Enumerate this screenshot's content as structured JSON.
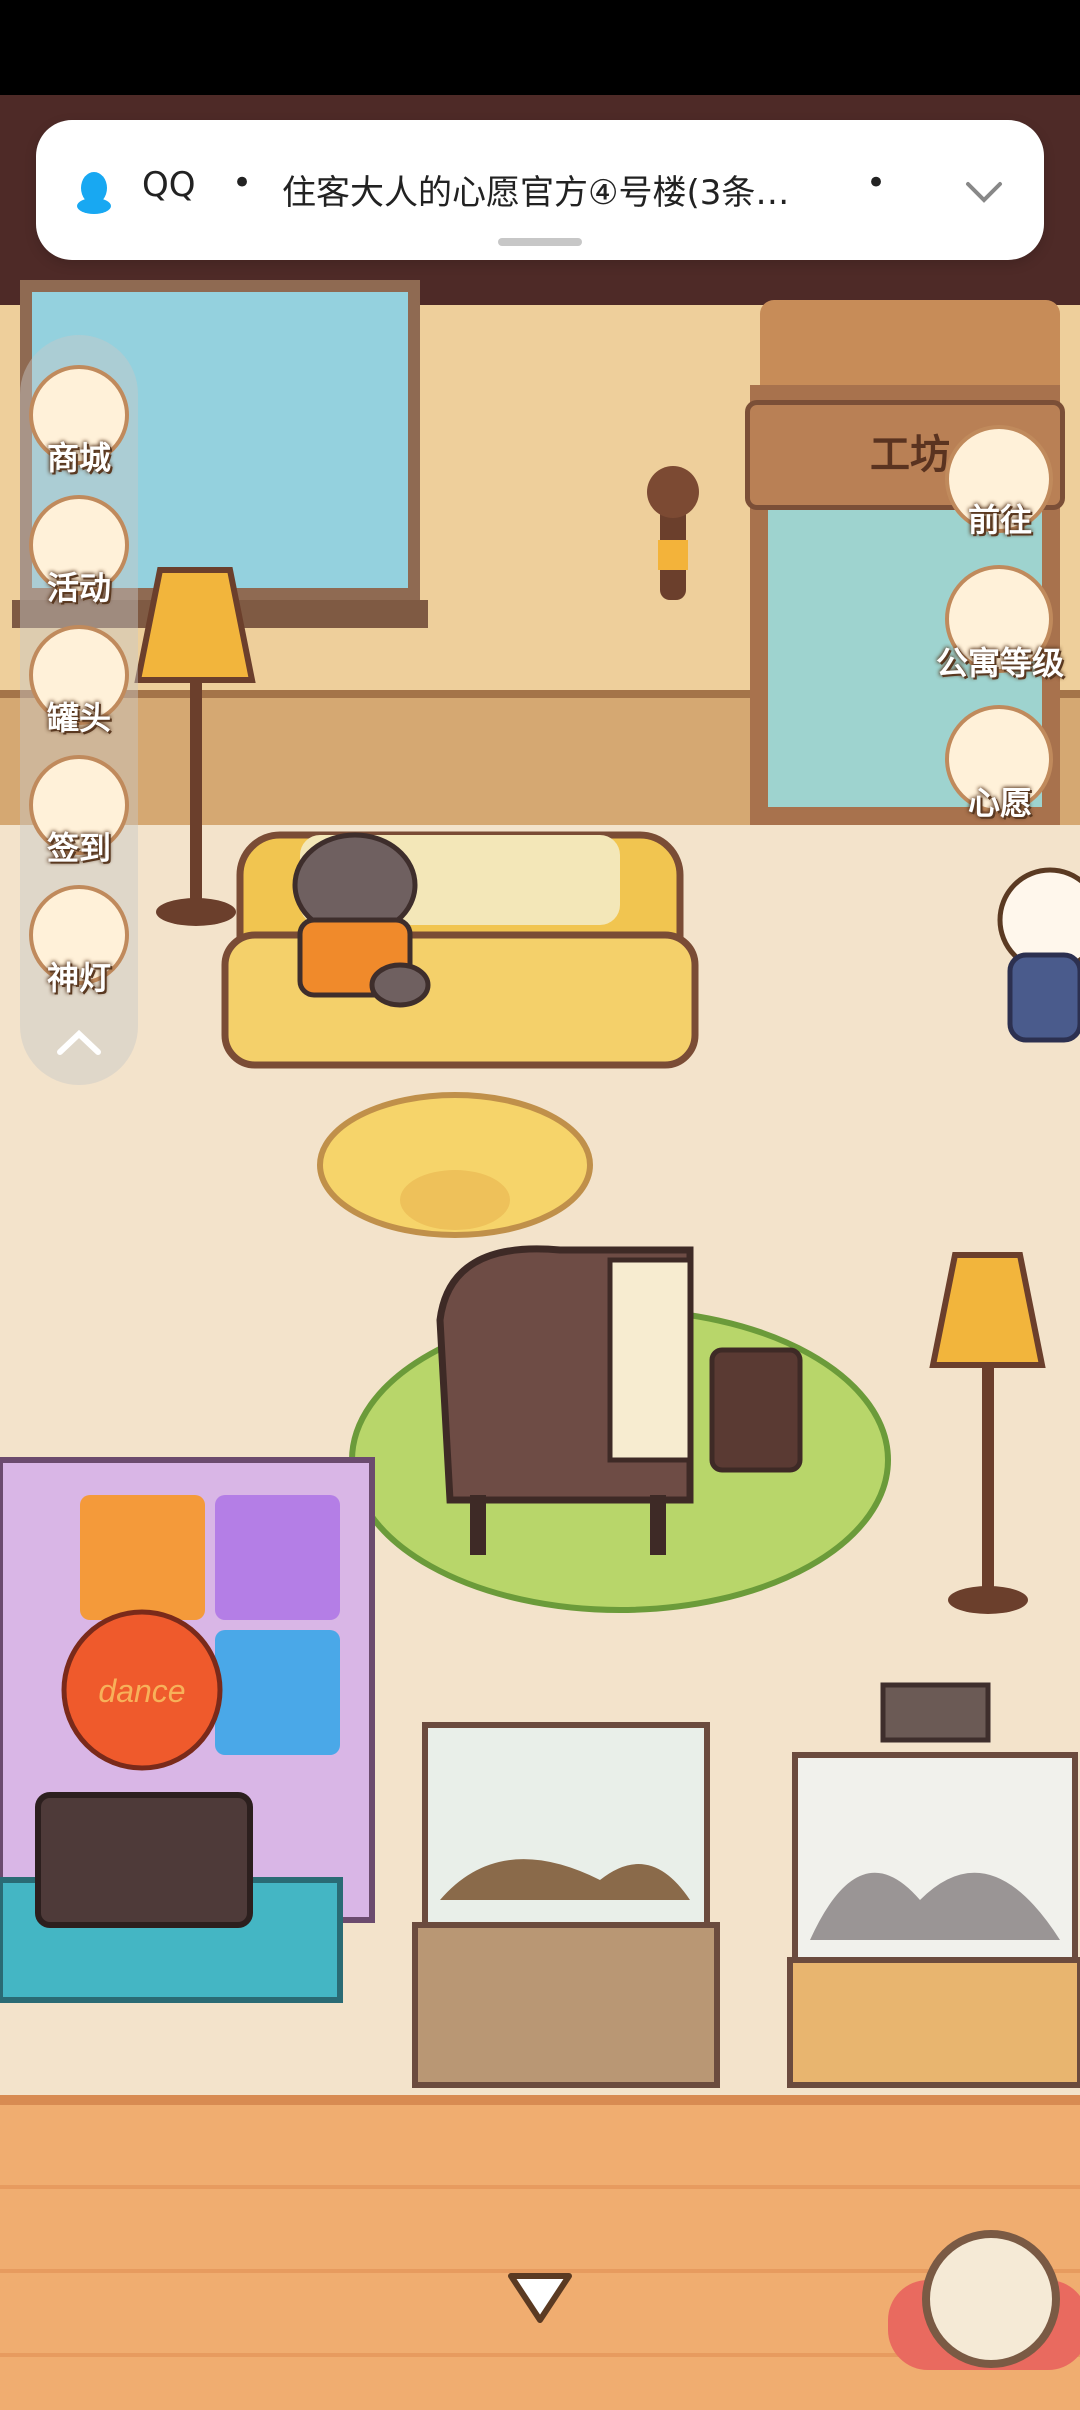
{
  "colors": {
    "status_bar": "#000000",
    "top_band": "#4e2a27",
    "wall": "#eecf9b",
    "floor": "#f3e3cb",
    "label_outline": "#5b3a22",
    "qq_blue": "#18a8f2"
  },
  "notification": {
    "app": "QQ",
    "separator": "•",
    "text": "住客大人的心愿官方④号楼(3条…",
    "separator2": "•",
    "expand_icon": "chevron-down-icon"
  },
  "room": {
    "door_sign": "工坊"
  },
  "left_menu": {
    "items": [
      {
        "label": "商城",
        "icon": "shop-icon"
      },
      {
        "label": "活动",
        "icon": "gift-icon"
      },
      {
        "label": "罐头",
        "icon": "can-icon"
      },
      {
        "label": "签到",
        "icon": "checkin-icon"
      },
      {
        "label": "神灯",
        "icon": "magic-lamp-icon"
      }
    ],
    "collapse_icon": "chevron-up-icon"
  },
  "right_menu": {
    "items": [
      {
        "label": "前往",
        "icon": "map-pin-icon"
      },
      {
        "label": "公寓等级",
        "icon": "sun-badge-icon"
      },
      {
        "label": "心愿",
        "icon": "heart-book-icon"
      }
    ]
  },
  "dance_pad": {
    "center_label": "dance"
  },
  "bottom": {
    "scroll_icon": "triangle-down-icon",
    "yarn_icon": "yarn-ball-icon"
  }
}
